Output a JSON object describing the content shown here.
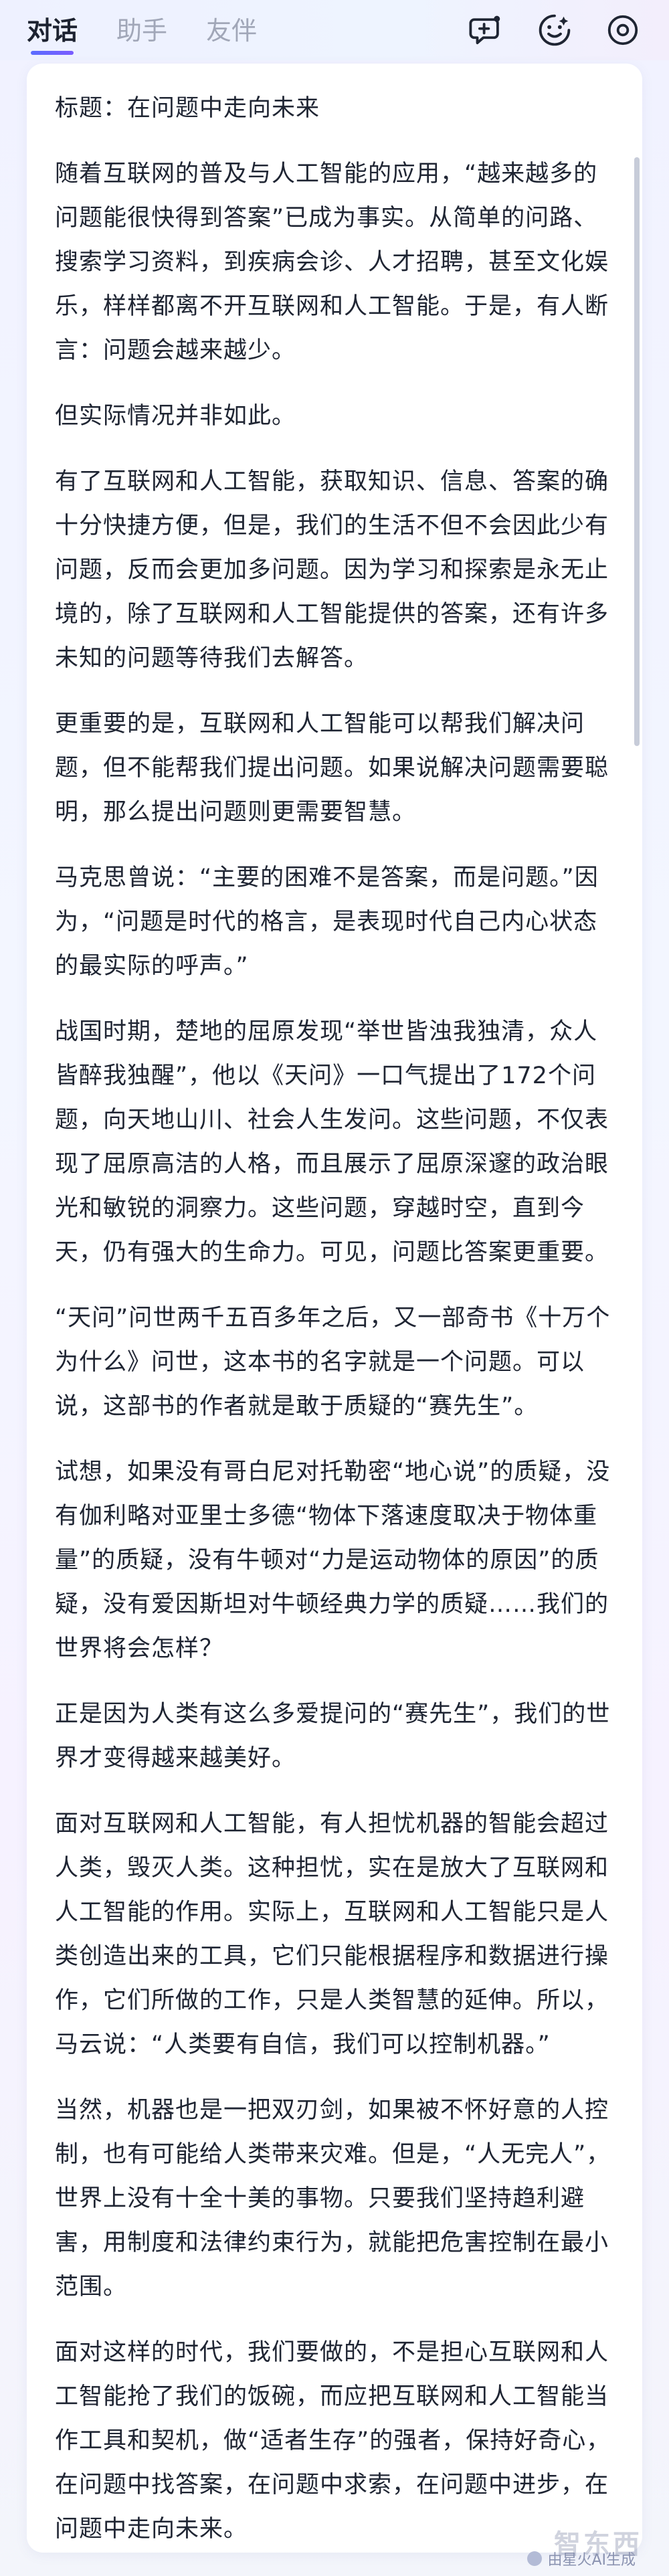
{
  "header": {
    "tabs": [
      {
        "label": "对话",
        "active": true
      },
      {
        "label": "助手",
        "active": false
      },
      {
        "label": "友伴",
        "active": false
      }
    ],
    "actions": [
      {
        "icon": "new-chat-icon"
      },
      {
        "icon": "assistant-face-icon"
      },
      {
        "icon": "settings-icon"
      }
    ]
  },
  "article": {
    "paragraphs": [
      "标题：在问题中走向未来",
      "随着互联网的普及与人工智能的应用，“越来越多的问题能很快得到答案”已成为事实。从简单的问路、搜索学习资料，到疾病会诊、人才招聘，甚至文化娱乐，样样都离不开互联网和人工智能。于是，有人断言：问题会越来越少。",
      "但实际情况并非如此。",
      "有了互联网和人工智能，获取知识、信息、答案的确十分快捷方便，但是，我们的生活不但不会因此少有问题，反而会更加多问题。因为学习和探索是永无止境的，除了互联网和人工智能提供的答案，还有许多未知的问题等待我们去解答。",
      "更重要的是，互联网和人工智能可以帮我们解决问题，但不能帮我们提出问题。如果说解决问题需要聪明，那么提出问题则更需要智慧。",
      "马克思曾说：“主要的困难不是答案，而是问题。”因为，“问题是时代的格言，是表现时代自己内心状态的最实际的呼声。”",
      "战国时期，楚地的屈原发现“举世皆浊我独清，众人皆醉我独醒”，他以《天问》一口气提出了172个问题，向天地山川、社会人生发问。这些问题，不仅表现了屈原高洁的人格，而且展示了屈原深邃的政治眼光和敏锐的洞察力。这些问题，穿越时空，直到今天，仍有强大的生命力。可见，问题比答案更重要。",
      "“天问”问世两千五百多年之后，又一部奇书《十万个为什么》问世，这本书的名字就是一个问题。可以说，这部书的作者就是敢于质疑的“赛先生”。",
      "试想，如果没有哥白尼对托勒密“地心说”的质疑，没有伽利略对亚里士多德“物体下落速度取决于物体重量”的质疑，没有牛顿对“力是运动物体的原因”的质疑，没有爱因斯坦对牛顿经典力学的质疑……我们的世界将会怎样？",
      "正是因为人类有这么多爱提问的“赛先生”，我们的世界才变得越来越美好。",
      "面对互联网和人工智能，有人担忧机器的智能会超过人类，毁灭人类。这种担忧，实在是放大了互联网和人工智能的作用。实际上，互联网和人工智能只是人类创造出来的工具，它们只能根据程序和数据进行操作，它们所做的工作，只是人类智慧的延伸。所以，马云说：“人类要有自信，我们可以控制机器。”",
      "当然，机器也是一把双刃剑，如果被不怀好意的人控制，也有可能给人类带来灾难。但是，“人无完人”，世界上没有十全十美的事物。只要我们坚持趋利避害，用制度和法律约束行为，就能把危害控制在最小范围。",
      "面对这样的时代，我们要做的，不是担心互联网和人工智能抢了我们的饭碗，而应把互联网和人工智能当作工具和契机，做“适者生存”的强者，保持好奇心，在问题中找答案，在问题中求索，在问题中进步，在问题中走向未来。"
    ]
  },
  "footer": {
    "credit": "由星火AI生成",
    "watermark": "智东西"
  }
}
